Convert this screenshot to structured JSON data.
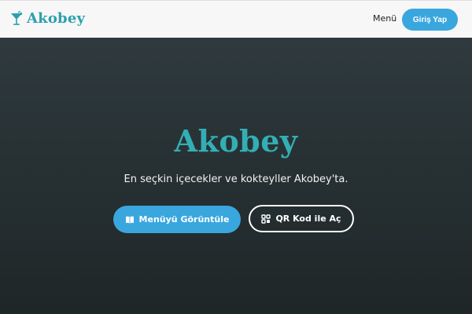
{
  "header": {
    "brand_name": "Akobey",
    "brand_icon": "cocktail-glass-icon",
    "nav_menu_label": "Menü",
    "login_label": "Giriş Yap"
  },
  "hero": {
    "title": "Akobey",
    "subtitle": "En seçkin içecekler ve kokteyller Akobey'ta.",
    "primary_button": {
      "label": "Menüyü Görüntüle",
      "icon": "book-icon"
    },
    "secondary_button": {
      "label": "QR Kod ile Aç",
      "icon": "qr-grid-icon"
    }
  },
  "colors": {
    "brand": "#2c9fae",
    "accent": "#3aa6de",
    "hero_bg": "#273133",
    "title": "#33aeb5"
  }
}
